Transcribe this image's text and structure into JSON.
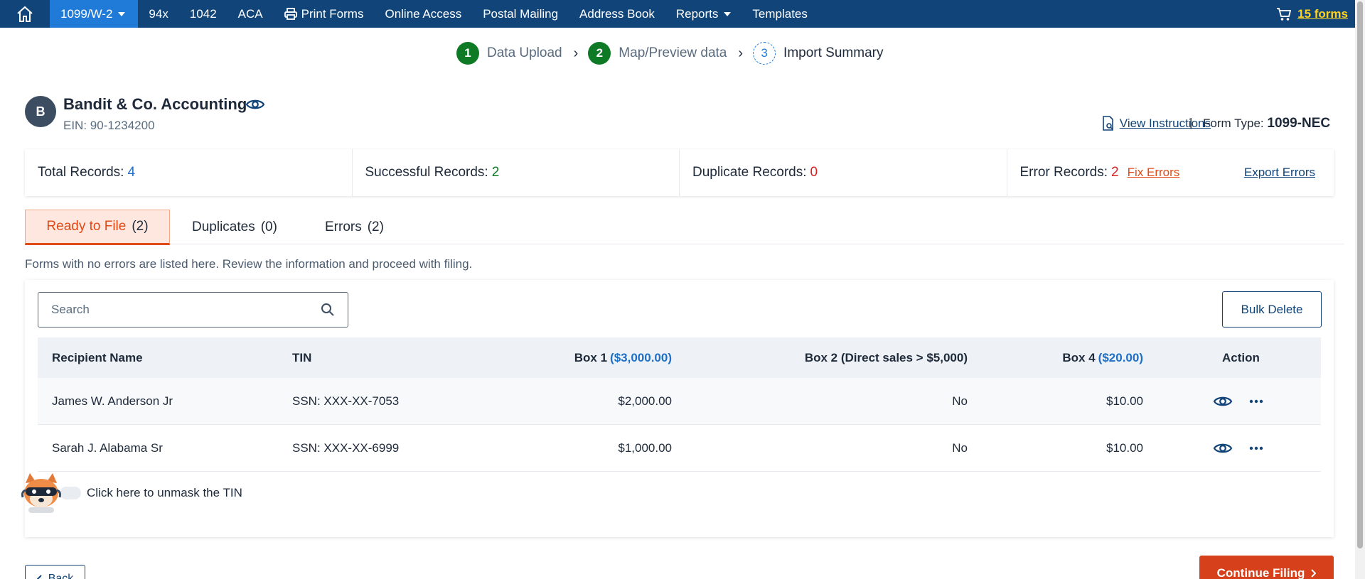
{
  "nav": {
    "items": [
      {
        "label": "1099/W-2",
        "dropdown": true,
        "active": true
      },
      {
        "label": "94x"
      },
      {
        "label": "1042"
      },
      {
        "label": "ACA"
      },
      {
        "label": "Print Forms",
        "icon": "printer-icon"
      },
      {
        "label": "Online Access"
      },
      {
        "label": "Postal Mailing"
      },
      {
        "label": "Address Book"
      },
      {
        "label": "Reports",
        "dropdown": true
      },
      {
        "label": "Templates"
      }
    ],
    "cart_label": "15 forms"
  },
  "stepper": {
    "steps": [
      {
        "num": "1",
        "label": "Data Upload",
        "state": "done"
      },
      {
        "num": "2",
        "label": "Map/Preview data",
        "state": "done"
      },
      {
        "num": "3",
        "label": "Import Summary",
        "state": "current"
      }
    ]
  },
  "company": {
    "initial": "B",
    "name": "Bandit & Co. Accounting",
    "ein": "EIN: 90-1234200"
  },
  "header": {
    "instructions_label": "View Instructions",
    "separator": "|",
    "form_type_label": "Form Type:",
    "form_type_value": "1099-NEC"
  },
  "stats": {
    "total_label": "Total Records:",
    "total_value": "4",
    "success_label": "Successful Records:",
    "success_value": "2",
    "duplicate_label": "Duplicate Records:",
    "duplicate_value": "0",
    "error_label": "Error Records:",
    "error_value": "2",
    "fix_errors": "Fix Errors",
    "export_errors": "Export Errors"
  },
  "tabs": [
    {
      "label": "Ready to File",
      "count": "(2)"
    },
    {
      "label": "Duplicates",
      "count": "(0)"
    },
    {
      "label": "Errors",
      "count": "(2)"
    }
  ],
  "info_text": "Forms with no errors are listed here. Review the information and proceed with filing.",
  "search": {
    "placeholder": "Search"
  },
  "bulk_delete": "Bulk Delete",
  "table": {
    "headers": {
      "name": "Recipient Name",
      "tin": "TIN",
      "box1": "Box 1",
      "box1_total": "($3,000.00)",
      "box2": "Box 2 (Direct sales > $5,000)",
      "box4": "Box 4",
      "box4_total": "($20.00)",
      "action": "Action"
    },
    "rows": [
      {
        "name": "James W. Anderson Jr",
        "tin": "SSN: XXX-XX-7053",
        "box1": "$2,000.00",
        "box2": "No",
        "box4": "$10.00"
      },
      {
        "name": "Sarah J. Alabama Sr",
        "tin": "SSN: XXX-XX-6999",
        "box1": "$1,000.00",
        "box2": "No",
        "box4": "$10.00"
      }
    ]
  },
  "unmask_text": "Click here to unmask the TIN",
  "buttons": {
    "back": "Back",
    "continue": "Continue Filing"
  },
  "colors": {
    "nav_bg": "#114478",
    "nav_active": "#1f7ad8",
    "success_green": "#0f7a25",
    "error_red": "#d72020",
    "accent_orange": "#e04a16",
    "cart_yellow": "#ffd21f"
  }
}
